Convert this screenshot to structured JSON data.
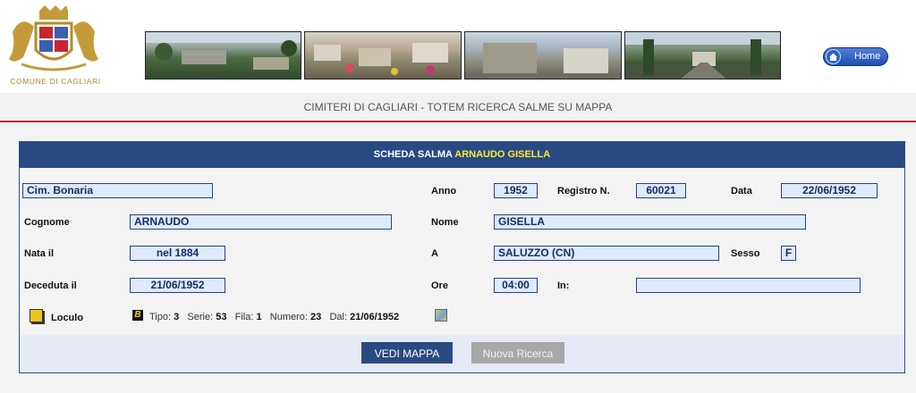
{
  "header": {
    "logo_text": "COMUNE DI CAGLIARI",
    "home_label": "Home",
    "icons": {
      "home": "home-icon",
      "logo": "coat-of-arms-logo"
    }
  },
  "subtitle": "CIMITERI DI CAGLIARI - TOTEM RICERCA SALME SU MAPPA",
  "card": {
    "title_prefix": "SCHEDA SALMA",
    "title_name": "ARNAUDO GISELLA",
    "cemetery": "Cim. Bonaria",
    "labels": {
      "anno": "Anno",
      "registro": "Registro N.",
      "data": "Data",
      "cognome": "Cognome",
      "nome": "Nome",
      "nata_il": "Nata il",
      "a": "A",
      "sesso": "Sesso",
      "deceduta_il": "Deceduta il",
      "ore": "Ore",
      "in": "In:",
      "loculo": "Loculo"
    },
    "values": {
      "anno": "1952",
      "registro": "60021",
      "data": "22/06/1952",
      "cognome": "ARNAUDO",
      "nome": "GISELLA",
      "nata_il": "nel 1884",
      "a": "SALUZZO (CN)",
      "sesso": "F",
      "deceduta_il": "21/06/1952",
      "ore": "04:00",
      "in": ""
    },
    "burial": {
      "tipo_label": "Tipo:",
      "tipo": "3",
      "serie_label": "Serie:",
      "serie": "53",
      "fila_label": "Fila:",
      "fila": "1",
      "numero_label": "Numero:",
      "numero": "23",
      "dal_label": "Dal:",
      "dal": "21/06/1952",
      "b_glyph": "B"
    },
    "buttons": {
      "map": "VEDI MAPPA",
      "new_search": "Nuova Ricerca"
    }
  },
  "colors": {
    "header_blue": "#284a82",
    "highlight_yellow": "#ffea2e",
    "field_bg": "#ddebfa",
    "red_rule": "#c7262e"
  }
}
